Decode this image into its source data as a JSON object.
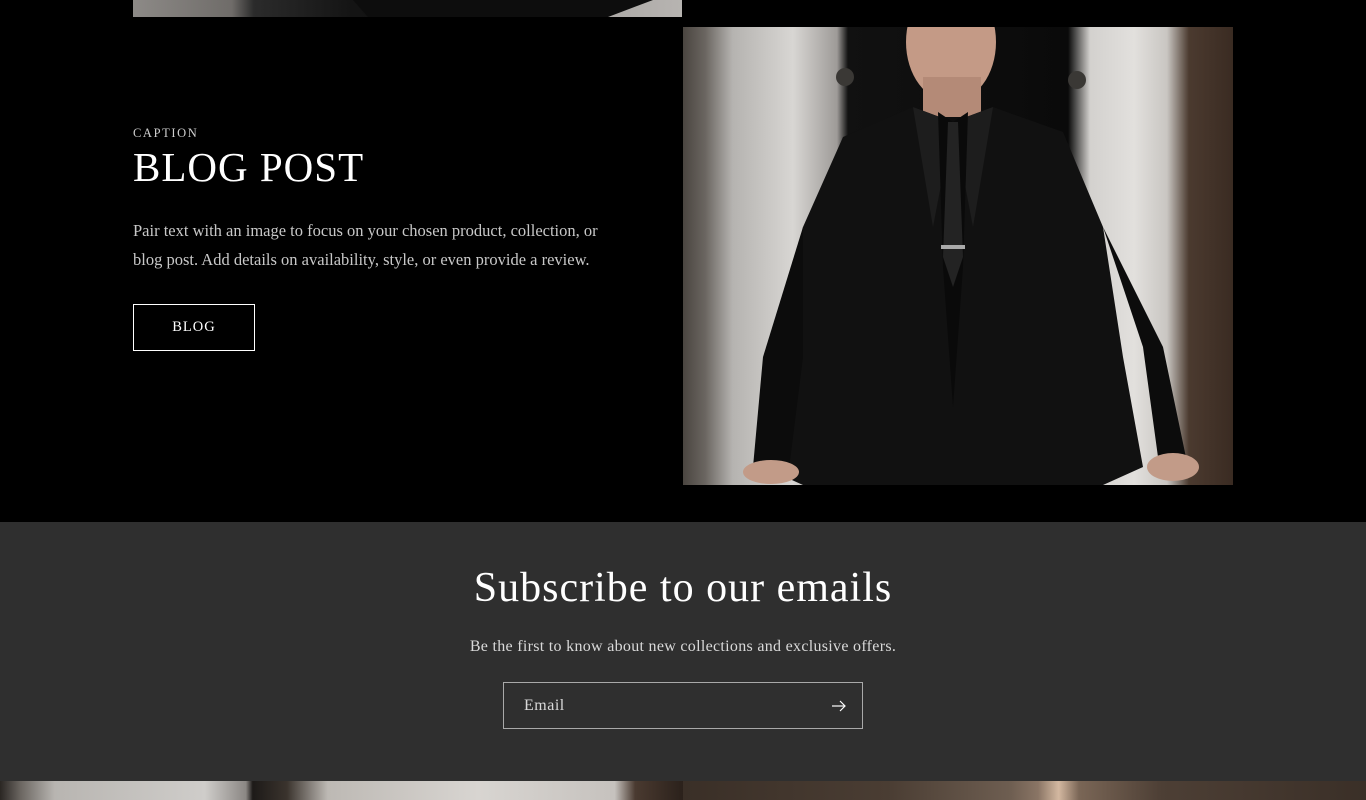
{
  "image_with_text": {
    "caption": "CAPTION",
    "heading": "BLOG POST",
    "description": "Pair text with an image to focus on your chosen product, collection, or blog post. Add details on availability, style, or even provide a review.",
    "button_label": "BLOG"
  },
  "newsletter": {
    "title": "Subscribe to our emails",
    "subtitle": "Be the first to know about new collections and exclusive offers.",
    "email_placeholder": "Email"
  },
  "colors": {
    "background": "#000000",
    "newsletter_background": "#2f2f2f",
    "text": "#ffffff",
    "muted_text": "#c8c8c8"
  },
  "icons": {
    "submit": "arrow-right-icon"
  }
}
